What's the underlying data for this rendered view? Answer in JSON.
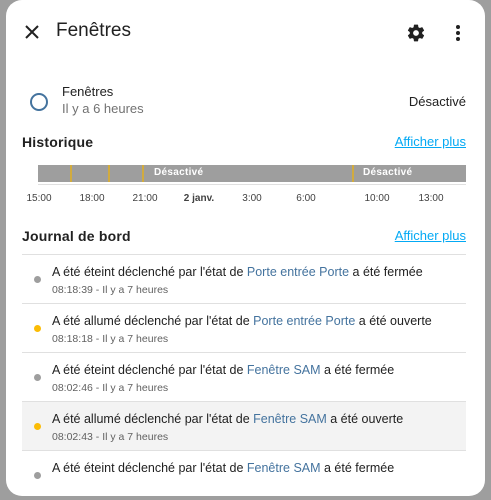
{
  "dialog": {
    "title": "Fenêtres",
    "icons": {
      "close": "close-icon",
      "settings": "gear-icon",
      "more": "more-vertical-icon"
    }
  },
  "entity": {
    "name": "Fenêtres",
    "last_changed": "Il y a 6 heures",
    "state": "Désactivé"
  },
  "history": {
    "title": "Historique",
    "show_more": "Afficher plus",
    "segments": [
      {
        "label": "Désactivé"
      },
      {
        "label": "Désactivé"
      }
    ],
    "ticks": [
      "15:00",
      "18:00",
      "21:00",
      "2 janv.",
      "3:00",
      "6:00",
      "10:00",
      "13:00"
    ]
  },
  "logbook": {
    "title": "Journal de bord",
    "show_more": "Afficher plus",
    "entries": [
      {
        "state": "off",
        "prefix": "A été éteint déclenché par l'état de ",
        "link": "Porte entrée Porte",
        "suffix": " a été fermée",
        "time": "08:18:39 - Il y a 7 heures"
      },
      {
        "state": "on",
        "prefix": "A été allumé déclenché par l'état de ",
        "link": "Porte entrée Porte",
        "suffix": " a été ouverte",
        "time": "08:18:18 - Il y a 7 heures"
      },
      {
        "state": "off",
        "prefix": "A été éteint déclenché par l'état de ",
        "link": "Fenêtre SAM",
        "suffix": " a été fermée",
        "time": "08:02:46 - Il y a 7 heures"
      },
      {
        "state": "on",
        "prefix": "A été allumé déclenché par l'état de ",
        "link": "Fenêtre SAM",
        "suffix": " a été ouverte",
        "time": "08:02:43 - Il y a 7 heures"
      },
      {
        "state": "off",
        "prefix": "A été éteint déclenché par l'état de ",
        "link": "Fenêtre SAM",
        "suffix": " a été fermée",
        "time": ""
      }
    ]
  },
  "colors": {
    "accent": "#03a9f4",
    "link": "#44739e",
    "on": "#fbbc05",
    "off": "#9e9e9e"
  }
}
